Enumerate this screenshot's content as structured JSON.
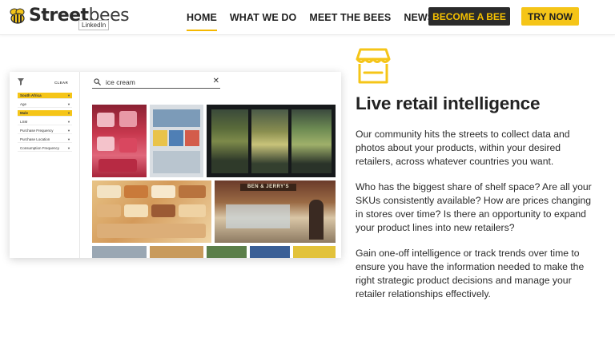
{
  "brand": {
    "name_bold": "Street",
    "name_light": "bees",
    "tooltip": "LinkedIn",
    "accent": "#f5c518",
    "dark": "#2b2b2b"
  },
  "nav": {
    "items": [
      {
        "label": "HOME",
        "active": true
      },
      {
        "label": "WHAT WE DO",
        "active": false
      },
      {
        "label": "MEET THE BEES",
        "active": false
      },
      {
        "label": "NEWS",
        "active": false
      }
    ],
    "become_label": "BECOME A BEE",
    "try_label": "TRY NOW"
  },
  "mock": {
    "clear_label": "CLEAR",
    "filters": [
      {
        "label": "South Africa",
        "selected": true
      },
      {
        "label": "Age",
        "selected": false
      },
      {
        "label": "Male",
        "selected": true
      },
      {
        "label": "LSM",
        "selected": false
      },
      {
        "label": "Purchase Frequency",
        "selected": false
      },
      {
        "label": "Purchase Location",
        "selected": false
      },
      {
        "label": "Consumption Frequency",
        "selected": false
      }
    ],
    "search_value": "ice cream",
    "storefront_sign": "BEN & JERRY'S"
  },
  "content": {
    "icon": "storefront-icon",
    "heading": "Live retail intelligence",
    "paragraphs": [
      "Our community hits the streets to collect data and photos about your products, within your desired retailers, across whatever countries you want.",
      "Who has the biggest share of shelf space? Are all your SKUs consistently available? How are prices changing in stores over time? Is there an opportunity to expand your product lines into new retailers?",
      "Gain one-off intelligence or track trends over time to ensure you have the information needed to make the right strategic product decisions and manage your retailer relationships effectively."
    ]
  }
}
